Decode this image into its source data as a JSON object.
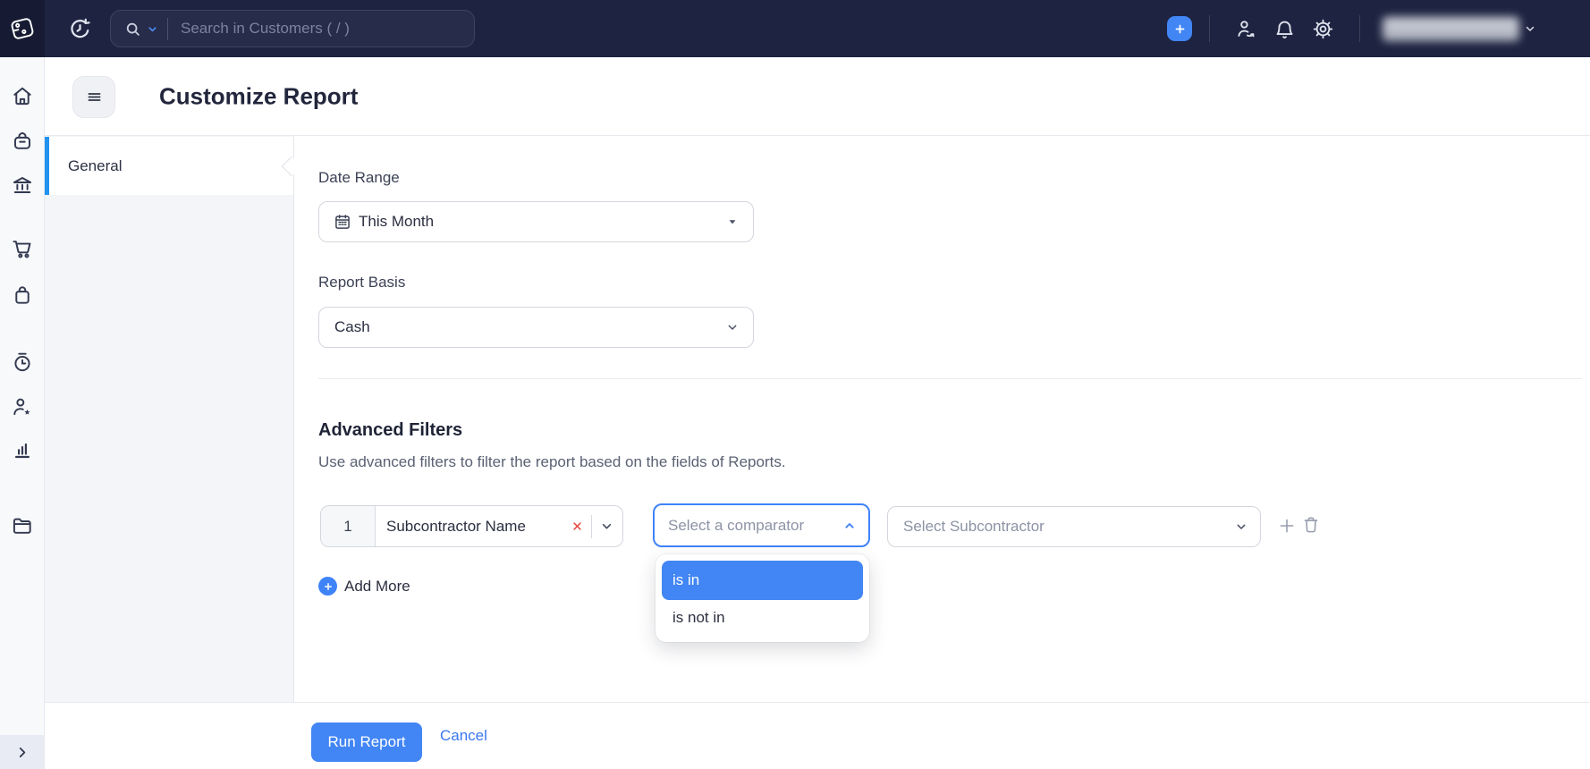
{
  "topbar": {
    "search_placeholder": "Search in Customers ( / )",
    "plus_tooltip": "+",
    "icons": [
      "books-logo",
      "history",
      "search",
      "search-scope-chevron",
      "add-plus",
      "referral-users",
      "notifications-bell",
      "settings-gear",
      "org-chevron-down"
    ]
  },
  "sidebar": {
    "items": [
      {
        "icon": "home"
      },
      {
        "icon": "items-bag"
      },
      {
        "icon": "banking"
      },
      {
        "icon": "sales-cart"
      },
      {
        "icon": "purchases-bag"
      },
      {
        "icon": "time-tracking"
      },
      {
        "icon": "accountant-person-star"
      },
      {
        "icon": "reports-chart"
      },
      {
        "icon": "documents-folder"
      }
    ],
    "expand_icon": "chevron-right"
  },
  "header": {
    "title": "Customize Report",
    "menu_icon": "hamburger"
  },
  "panel": {
    "tabs": [
      {
        "label": "General",
        "active": true
      }
    ]
  },
  "form": {
    "date_range": {
      "label": "Date Range",
      "value": "This Month",
      "icon": "calendar"
    },
    "report_basis": {
      "label": "Report Basis",
      "value": "Cash"
    },
    "advanced_filters": {
      "title": "Advanced Filters",
      "description": "Use advanced filters to filter the report based on the fields of Reports."
    },
    "filter_row": {
      "index": "1",
      "field": "Subcontractor Name",
      "comparator_placeholder": "Select a comparator",
      "value_placeholder": "Select Subcontractor"
    },
    "add_more_label": "Add More"
  },
  "comparator_dropdown": {
    "options": [
      {
        "label": "is in",
        "selected": true
      },
      {
        "label": "is not in",
        "selected": false
      }
    ]
  },
  "footer": {
    "run_label": "Run Report",
    "cancel_label": "Cancel"
  },
  "colors": {
    "topbar_bg": "#1d2340",
    "accent_blue": "#4285f4",
    "focus_border_blue": "#3f83f8",
    "active_tab_bar_blue": "#2192ef",
    "danger_red": "#e5483e",
    "link_blue": "#3a78ef",
    "panel_bg": "#f3f5f8"
  }
}
